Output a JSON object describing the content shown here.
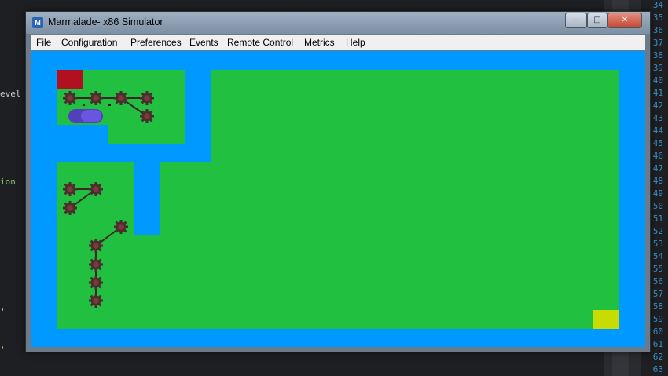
{
  "window": {
    "title": "Marmalade- x86 Simulator",
    "app_icon_letter": "M",
    "controls": {
      "minimize": "—",
      "maximize": "□",
      "close": "✕"
    }
  },
  "menu": {
    "items": [
      "File",
      "Configuration",
      "Preferences",
      "Events",
      "Remote Control",
      "Metrics",
      "Help"
    ]
  },
  "editor": {
    "fragments": [
      "evel",
      "ion",
      ",",
      ","
    ],
    "line_numbers": [
      "34",
      "35",
      "36",
      "37",
      "38",
      "39",
      "40",
      "41",
      "42",
      "43",
      "44",
      "45",
      "46",
      "47",
      "48",
      "49",
      "50",
      "51",
      "52",
      "53",
      "54",
      "55",
      "56",
      "57",
      "58",
      "59",
      "60",
      "61",
      "62",
      "63"
    ]
  },
  "game": {
    "colors": {
      "water": "#0099ff",
      "grass": "#22c040",
      "start_tile": "#b01020",
      "goal_tile": "#c8dc00",
      "node": "#4a2e2e",
      "player": "#5c46c8"
    },
    "icons": {
      "node": "gear-node-icon",
      "player": "capsule-player-icon"
    }
  }
}
